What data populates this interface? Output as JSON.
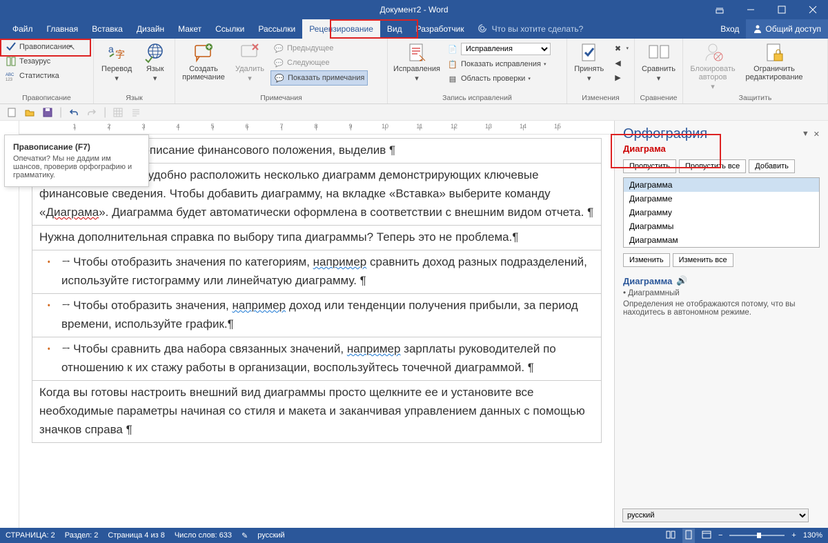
{
  "title": "Документ2 - Word",
  "tabs": [
    "Файл",
    "Главная",
    "Вставка",
    "Дизайн",
    "Макет",
    "Ссылки",
    "Рассылки",
    "Рецензирование",
    "Вид",
    "Разработчик"
  ],
  "active_tab": "Рецензирование",
  "tellme": "Что вы хотите сделать?",
  "sign_in": "Вход",
  "share": "Общий доступ",
  "ribbon": {
    "proof": {
      "spelling": "Правописание",
      "thesaurus": "Тезаурус",
      "stats": "Статистика",
      "group": "Правописание"
    },
    "lang": {
      "translate": "Перевод",
      "language": "Язык",
      "group": "Язык"
    },
    "comments": {
      "new": "Создать примечание",
      "del": "Удалить",
      "prev": "Предыдущее",
      "next": "Следующее",
      "show": "Показать примечания",
      "group": "Примечания"
    },
    "tracking": {
      "track": "Исправления",
      "mode": "Исправления",
      "show_markup": "Показать исправления",
      "pane": "Область проверки",
      "group": "Запись исправлений"
    },
    "changes": {
      "accept": "Принять",
      "group": "Изменения"
    },
    "compare": {
      "compare": "Сравнить",
      "group": "Сравнение"
    },
    "protect": {
      "block": "Блокировать авторов",
      "restrict": "Ограничить редактирование",
      "group": "Защитить"
    }
  },
  "tooltip": {
    "title": "Правописание (F7)",
    "body": "Опечатки? Мы не дадим им шансов, проверив орфографию и грамматику."
  },
  "doc": {
    "p1": "м разделе краткое описание финансового положения, выделив ¶",
    "p2": "Здесь также можно удобно расположить несколько диаграмм демонстрирующих ключевые финансовые сведения. Чтобы добавить диаграмму, на вкладке «Вставка» выберите команду «",
    "p2_err": "Диаграма",
    "p2_b": "». Диаграмма будет автоматически оформлена в соответствии с внешним видом отчета. ¶",
    "p3": "Нужна дополнительная справка по выбору типа диаграммы? Теперь это не проблема.¶",
    "li1a": "Чтобы отобразить значения по категориям, ",
    "li1b": " сравнить доход разных подразделений, используйте гистограмму или линейчатую диаграмму. ¶",
    "li2a": "Чтобы отобразить значения, ",
    "li2b": " доход или тенденции получения прибыли, за период времени, используйте график.¶",
    "li3a": "Чтобы сравнить два набора связанных значений, ",
    "li3b": " зарплаты руководителей по отношению к их стажу работы в организации, воспользуйтесь точечной диаграммой. ¶",
    "p4": "Когда вы готовы настроить внешний вид диаграммы просто щелкните ее и установите все необходимые параметры начиная со стиля и макета и заканчивая управлением данных с помощью значков справа ¶",
    "naprimer": "например"
  },
  "pane": {
    "title": "Орфография",
    "word": "Диаграма",
    "skip": "Пропустить",
    "skip_all": "Пропустить все",
    "add": "Добавить",
    "suggestions": [
      "Диаграмма",
      "Диаграмме",
      "Диаграмму",
      "Диаграммы",
      "Диаграммам"
    ],
    "change": "Изменить",
    "change_all": "Изменить все",
    "heading": "Диаграмма",
    "forms": "• Диаграммный",
    "offline": "Определения не отображаются потому, что вы находитесь в автономном режиме.",
    "lang": "русский"
  },
  "status": {
    "page": "СТРАНИЦА: 2",
    "section": "Раздел: 2",
    "pageof": "Страница 4 из 8",
    "words": "Число слов: 633",
    "lang": "русский",
    "zoom": "130%"
  },
  "ruler_marks": [
    1,
    2,
    3,
    4,
    5,
    6,
    7,
    8,
    9,
    10,
    11,
    12,
    13,
    14,
    15
  ]
}
